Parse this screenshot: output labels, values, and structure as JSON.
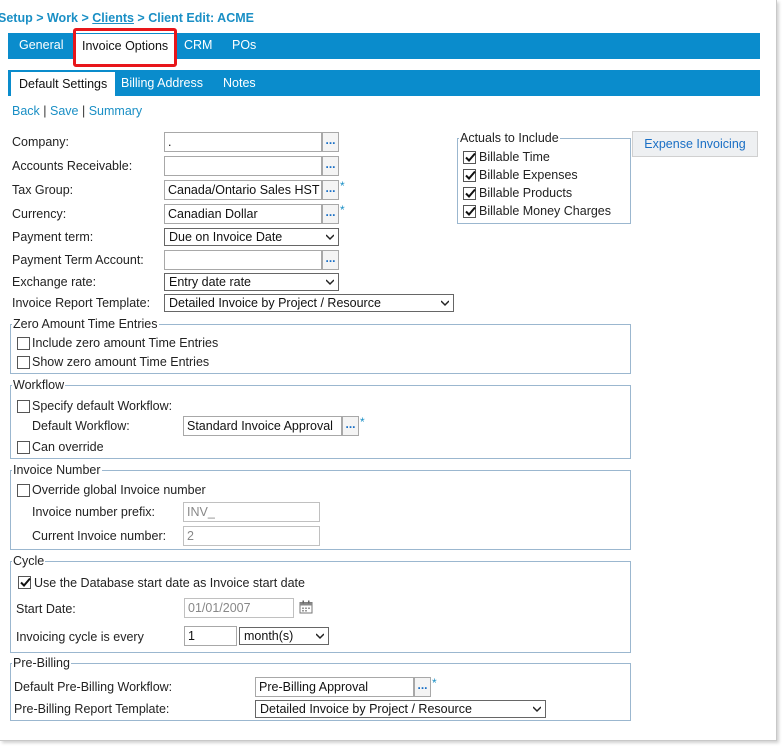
{
  "breadcrumb": {
    "setup": "Setup",
    "sep1": " > ",
    "work": "Work",
    "sep2": " > ",
    "clients": "Clients",
    "sep3": " > ",
    "current": "Client Edit: ACME"
  },
  "tabs": [
    "General",
    "Invoice Options",
    "CRM",
    "POs"
  ],
  "subtabs": [
    "Default Settings",
    "Billing Address",
    "Notes"
  ],
  "actions": {
    "back": "Back",
    "save": "Save",
    "summary": "Summary",
    "sep": " | "
  },
  "form": {
    "company": {
      "label": "Company:",
      "value": "."
    },
    "ar": {
      "label": "Accounts Receivable:",
      "value": ""
    },
    "tax_group": {
      "label": "Tax Group:",
      "value": "Canada/Ontario Sales HST"
    },
    "currency": {
      "label": "Currency:",
      "value": "Canadian Dollar"
    },
    "payment_term": {
      "label": "Payment term:",
      "value": "Due on Invoice Date"
    },
    "payment_term_account": {
      "label": "Payment Term Account:",
      "value": ""
    },
    "exchange_rate": {
      "label": "Exchange rate:",
      "value": "Entry date rate"
    },
    "report_template": {
      "label": "Invoice Report Template:",
      "value": "Detailed Invoice by Project / Resource"
    },
    "lookup_glyph": "...",
    "required": "*"
  },
  "actuals": {
    "legend": "Actuals to Include",
    "items": [
      "Billable Time",
      "Billable Expenses",
      "Billable Products",
      "Billable Money Charges"
    ],
    "checked": [
      true,
      true,
      true,
      true
    ]
  },
  "expense_button": "Expense Invoicing",
  "zero": {
    "legend": "Zero Amount Time Entries",
    "include": "Include zero amount Time Entries",
    "show": "Show zero amount Time Entries"
  },
  "workflow": {
    "legend": "Workflow",
    "specify": "Specify default Workflow:",
    "default_label": "Default Workflow:",
    "default_value": "Standard Invoice Approval",
    "override": "Can override"
  },
  "invnum": {
    "legend": "Invoice Number",
    "override": "Override global Invoice number",
    "prefix_label": "Invoice number prefix:",
    "prefix_value": "INV_",
    "current_label": "Current Invoice number:",
    "current_value": "2"
  },
  "cycle": {
    "legend": "Cycle",
    "use_db": "Use the Database start date as Invoice start date",
    "start_label": "Start Date:",
    "start_value": "01/01/2007",
    "every_label": "Invoicing cycle is every",
    "every_value": "1",
    "unit": "month(s)"
  },
  "prebilling": {
    "legend": "Pre-Billing",
    "wf_label": "Default Pre-Billing Workflow:",
    "wf_value": "Pre-Billing Approval",
    "tpl_label": "Pre-Billing Report Template:",
    "tpl_value": "Detailed Invoice by Project / Resource"
  },
  "colors": {
    "accent": "#0a8ccc",
    "link": "#1a8fc5",
    "highlight": "#e8161a"
  }
}
